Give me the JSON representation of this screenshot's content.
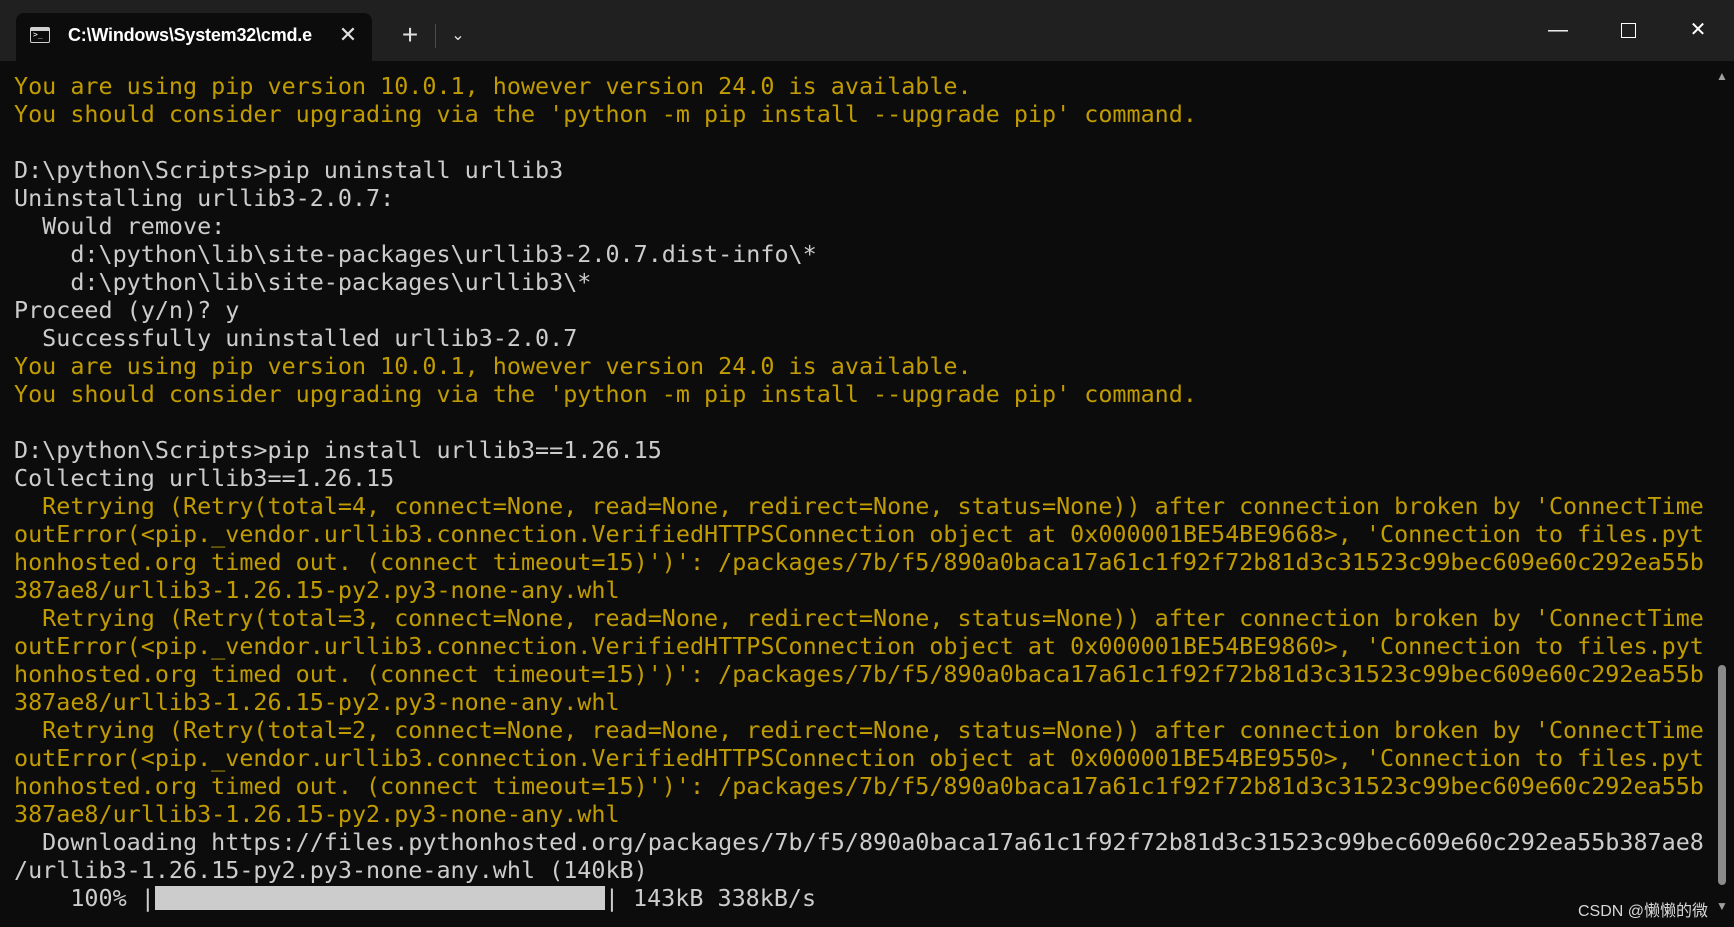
{
  "window": {
    "tab_title": "C:\\Windows\\System32\\cmd.e",
    "tab_close_glyph": "✕",
    "new_tab_glyph": "+",
    "dropdown_glyph": "⌄",
    "minimize_glyph": "—",
    "close_glyph": "✕"
  },
  "terminal": {
    "colors": {
      "white": "#cccccc",
      "yellow": "#c19c00",
      "background": "#0c0c0c"
    },
    "lines": [
      {
        "text": "You are using pip version 10.0.1, however version 24.0 is available.",
        "color": "yellow"
      },
      {
        "text": "You should consider upgrading via the 'python -m pip install --upgrade pip' command.",
        "color": "yellow"
      },
      {
        "text": "",
        "color": "white"
      },
      {
        "text": "D:\\python\\Scripts>pip uninstall urllib3",
        "color": "white"
      },
      {
        "text": "Uninstalling urllib3-2.0.7:",
        "color": "white"
      },
      {
        "text": "  Would remove:",
        "color": "white"
      },
      {
        "text": "    d:\\python\\lib\\site-packages\\urllib3-2.0.7.dist-info\\*",
        "color": "white"
      },
      {
        "text": "    d:\\python\\lib\\site-packages\\urllib3\\*",
        "color": "white"
      },
      {
        "text": "Proceed (y/n)? y",
        "color": "white"
      },
      {
        "text": "  Successfully uninstalled urllib3-2.0.7",
        "color": "white"
      },
      {
        "text": "You are using pip version 10.0.1, however version 24.0 is available.",
        "color": "yellow"
      },
      {
        "text": "You should consider upgrading via the 'python -m pip install --upgrade pip' command.",
        "color": "yellow"
      },
      {
        "text": "",
        "color": "white"
      },
      {
        "text": "D:\\python\\Scripts>pip install urllib3==1.26.15",
        "color": "white"
      },
      {
        "text": "Collecting urllib3==1.26.15",
        "color": "white"
      },
      {
        "text": "  Retrying (Retry(total=4, connect=None, read=None, redirect=None, status=None)) after connection broken by 'ConnectTime",
        "color": "yellow"
      },
      {
        "text": "outError(<pip._vendor.urllib3.connection.VerifiedHTTPSConnection object at 0x000001BE54BE9668>, 'Connection to files.pyt",
        "color": "yellow"
      },
      {
        "text": "honhosted.org timed out. (connect timeout=15)')': /packages/7b/f5/890a0baca17a61c1f92f72b81d3c31523c99bec609e60c292ea55b",
        "color": "yellow"
      },
      {
        "text": "387ae8/urllib3-1.26.15-py2.py3-none-any.whl",
        "color": "yellow"
      },
      {
        "text": "  Retrying (Retry(total=3, connect=None, read=None, redirect=None, status=None)) after connection broken by 'ConnectTime",
        "color": "yellow"
      },
      {
        "text": "outError(<pip._vendor.urllib3.connection.VerifiedHTTPSConnection object at 0x000001BE54BE9860>, 'Connection to files.pyt",
        "color": "yellow"
      },
      {
        "text": "honhosted.org timed out. (connect timeout=15)')': /packages/7b/f5/890a0baca17a61c1f92f72b81d3c31523c99bec609e60c292ea55b",
        "color": "yellow"
      },
      {
        "text": "387ae8/urllib3-1.26.15-py2.py3-none-any.whl",
        "color": "yellow"
      },
      {
        "text": "  Retrying (Retry(total=2, connect=None, read=None, redirect=None, status=None)) after connection broken by 'ConnectTime",
        "color": "yellow"
      },
      {
        "text": "outError(<pip._vendor.urllib3.connection.VerifiedHTTPSConnection object at 0x000001BE54BE9550>, 'Connection to files.pyt",
        "color": "yellow"
      },
      {
        "text": "honhosted.org timed out. (connect timeout=15)')': /packages/7b/f5/890a0baca17a61c1f92f72b81d3c31523c99bec609e60c292ea55b",
        "color": "yellow"
      },
      {
        "text": "387ae8/urllib3-1.26.15-py2.py3-none-any.whl",
        "color": "yellow"
      },
      {
        "text": "  Downloading https://files.pythonhosted.org/packages/7b/f5/890a0baca17a61c1f92f72b81d3c31523c99bec609e60c292ea55b387ae8",
        "color": "white"
      },
      {
        "text": "/urllib3-1.26.15-py2.py3-none-any.whl (140kB)",
        "color": "white"
      }
    ],
    "progress": {
      "prefix": "    100% |",
      "suffix": "| 143kB 338kB/s",
      "fraction": 1.0
    }
  },
  "watermark": "CSDN @懒懒的微"
}
